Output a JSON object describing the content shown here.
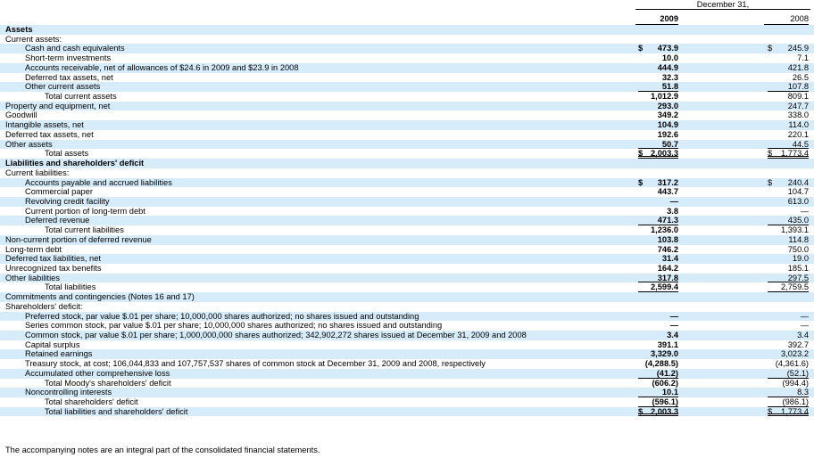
{
  "header": {
    "period": "December 31,",
    "year1": "2009",
    "year2": "2008"
  },
  "rows": [
    {
      "label": "Assets",
      "indent": 0,
      "bold": true,
      "shade": true
    },
    {
      "label": "Current assets:",
      "indent": 0,
      "shade": false
    },
    {
      "label": "Cash and cash equivalents",
      "indent": 2,
      "v1": "473.9",
      "v2": "245.9",
      "dollar": true,
      "shade": true
    },
    {
      "label": "Short-term investments",
      "indent": 2,
      "v1": "10.0",
      "v2": "7.1",
      "shade": false
    },
    {
      "label": "Accounts receivable, net of allowances of $24.6 in 2009 and $23.9 in 2008",
      "indent": 2,
      "v1": "444.9",
      "v2": "421.8",
      "shade": true
    },
    {
      "label": "Deferred tax assets, net",
      "indent": 2,
      "v1": "32.3",
      "v2": "26.5",
      "shade": false
    },
    {
      "label": "Other current assets",
      "indent": 2,
      "v1": "51.8",
      "v2": "107.8",
      "under": 1,
      "shade": true
    },
    {
      "label": "Total current assets",
      "indent": 4,
      "v1": "1,012.9",
      "v2": "809.1",
      "shade": false
    },
    {
      "label": "Property and equipment, net",
      "indent": 0,
      "v1": "293.0",
      "v2": "247.7",
      "shade": true
    },
    {
      "label": "Goodwill",
      "indent": 0,
      "v1": "349.2",
      "v2": "338.0",
      "shade": false
    },
    {
      "label": "Intangible assets, net",
      "indent": 0,
      "v1": "104.9",
      "v2": "114.0",
      "shade": true
    },
    {
      "label": "Deferred tax assets, net",
      "indent": 0,
      "v1": "192.6",
      "v2": "220.1",
      "shade": false
    },
    {
      "label": "Other assets",
      "indent": 0,
      "v1": "50.7",
      "v2": "44.5",
      "under": 1,
      "shade": true
    },
    {
      "label": "Total assets",
      "indent": 4,
      "v1": "2,003.3",
      "v2": "1,773.4",
      "dollar": true,
      "under": 2,
      "shade": false
    },
    {
      "label": "Liabilities and shareholders' deficit",
      "indent": 0,
      "bold": true,
      "shade": true
    },
    {
      "label": "Current liabilities:",
      "indent": 0,
      "shade": false
    },
    {
      "label": "Accounts payable and accrued liabilities",
      "indent": 2,
      "v1": "317.2",
      "v2": "240.4",
      "dollar": true,
      "shade": true
    },
    {
      "label": "Commercial paper",
      "indent": 2,
      "v1": "443.7",
      "v2": "104.7",
      "shade": false
    },
    {
      "label": "Revolving credit facility",
      "indent": 2,
      "v1": "—",
      "v2": "613.0",
      "shade": true
    },
    {
      "label": "Current portion of long-term debt",
      "indent": 2,
      "v1": "3.8",
      "v2": "—",
      "shade": false
    },
    {
      "label": "Deferred revenue",
      "indent": 2,
      "v1": "471.3",
      "v2": "435.0",
      "under": 1,
      "shade": true
    },
    {
      "label": "Total current liabilities",
      "indent": 4,
      "v1": "1,236.0",
      "v2": "1,393.1",
      "shade": false
    },
    {
      "label": "Non-current portion of deferred revenue",
      "indent": 0,
      "v1": "103.8",
      "v2": "114.8",
      "shade": true
    },
    {
      "label": "Long-term debt",
      "indent": 0,
      "v1": "746.2",
      "v2": "750.0",
      "shade": false
    },
    {
      "label": "Deferred tax liabilities, net",
      "indent": 0,
      "v1": "31.4",
      "v2": "19.0",
      "shade": true
    },
    {
      "label": "Unrecognized tax benefits",
      "indent": 0,
      "v1": "164.2",
      "v2": "185.1",
      "shade": false
    },
    {
      "label": "Other liabilities",
      "indent": 0,
      "v1": "317.8",
      "v2": "297.5",
      "under": 1,
      "shade": true
    },
    {
      "label": "Total liabilities",
      "indent": 4,
      "v1": "2,599.4",
      "v2": "2,759.5",
      "under": 1,
      "shade": false
    },
    {
      "label": "Commitments and contingencies (Notes 16 and 17)",
      "indent": 0,
      "shade": true
    },
    {
      "label": "Shareholders' deficit:",
      "indent": 0,
      "shade": false
    },
    {
      "label": "Preferred stock, par value $.01 per share; 10,000,000 shares authorized; no shares issued and outstanding",
      "indent": 2,
      "v1": "—",
      "v2": "—",
      "shade": true
    },
    {
      "label": "Series common stock, par value $.01 per share; 10,000,000 shares authorized; no shares issued and outstanding",
      "indent": 2,
      "v1": "—",
      "v2": "—",
      "shade": false
    },
    {
      "label": "Common stock, par value $.01 per share; 1,000,000,000 shares authorized; 342,902,272 shares issued at December 31, 2009 and 2008",
      "indent": 2,
      "v1": "3.4",
      "v2": "3.4",
      "shade": true
    },
    {
      "label": "Capital surplus",
      "indent": 2,
      "v1": "391.1",
      "v2": "392.7",
      "shade": false
    },
    {
      "label": "Retained earnings",
      "indent": 2,
      "v1": "3,329.0",
      "v2": "3,023.2",
      "shade": true
    },
    {
      "label": "Treasury stock, at cost; 106,044,833 and 107,757,537 shares of common stock at December 31, 2009 and 2008, respectively",
      "indent": 2,
      "v1": "(4,288.5)",
      "v2": "(4,361.6)",
      "shade": false
    },
    {
      "label": "Accumulated other comprehensive loss",
      "indent": 2,
      "v1": "(41.2)",
      "v2": "(52.1)",
      "under": 1,
      "shade": true
    },
    {
      "label": "Total Moody's shareholders' deficit",
      "indent": 4,
      "v1": "(606.2)",
      "v2": "(994.4)",
      "shade": false
    },
    {
      "label": "Noncontrolling interests",
      "indent": 2,
      "v1": "10.1",
      "v2": "8.3",
      "under": 1,
      "shade": true
    },
    {
      "label": "Total shareholders' deficit",
      "indent": 4,
      "v1": "(596.1)",
      "v2": "(986.1)",
      "under": 1,
      "shade": false
    },
    {
      "label": "Total liabilities and shareholders' deficit",
      "indent": 4,
      "v1": "2,003.3",
      "v2": "1,773.4",
      "dollar": true,
      "under": 2,
      "shade": true
    }
  ],
  "footnote": "The accompanying notes are an integral part of the consolidated financial statements.",
  "colors": {
    "shade": "#d6ecfa",
    "text": "#000000"
  }
}
